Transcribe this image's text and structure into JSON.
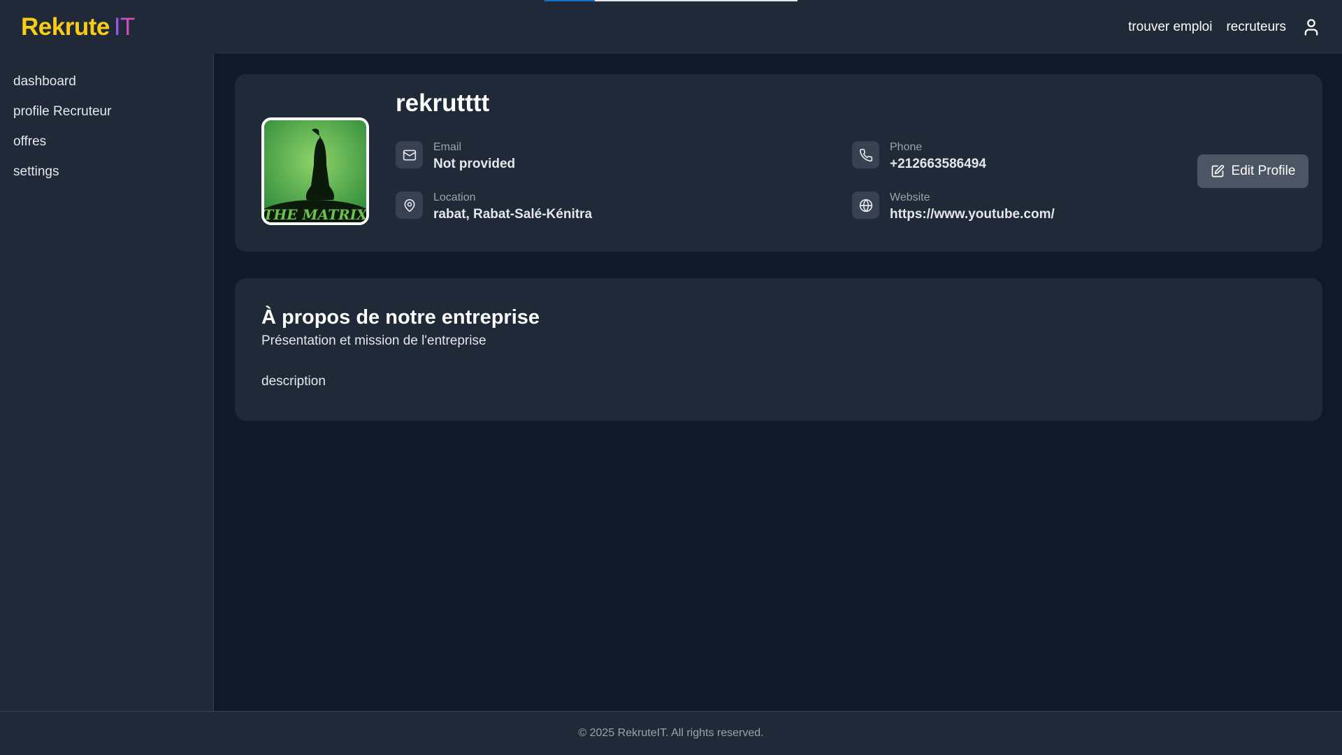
{
  "header": {
    "logo_part1": "Rekrute",
    "logo_part2": "IT",
    "nav": [
      "trouver emploi",
      "recruteurs"
    ],
    "user_icon": "user-icon",
    "loading_progress": 0.2
  },
  "sidebar": {
    "items": [
      {
        "label": "dashboard"
      },
      {
        "label": "profile Recruteur"
      },
      {
        "label": "offres"
      },
      {
        "label": "settings"
      }
    ]
  },
  "profile": {
    "name": "rekrutttt",
    "email_label": "Email",
    "email_value": "Not provided",
    "phone_label": "Phone",
    "phone_value": "+212663586494",
    "location_label": "Location",
    "location_value": "rabat, Rabat-Salé-Kénitra",
    "website_label": "Website",
    "website_value": "https://www.youtube.com/",
    "edit_button": "Edit Profile",
    "avatar_text": "THE MATRIX"
  },
  "about": {
    "title": "À propos de notre entreprise",
    "subtitle": "Présentation et mission de l'entreprise",
    "description": "description"
  },
  "footer": {
    "text": "© 2025 RekruteIT. All rights reserved."
  },
  "colors": {
    "background": "#111827",
    "panel": "#1f2937",
    "logo_yellow": "#facc15",
    "logo_purple": "#a855f7",
    "button": "#4b5563"
  }
}
